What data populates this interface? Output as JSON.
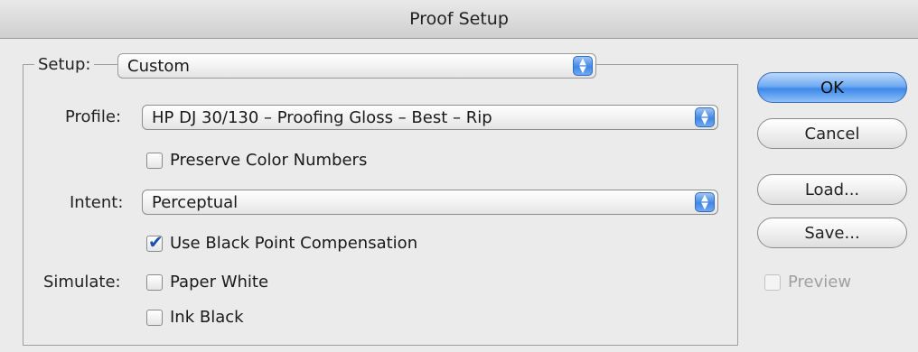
{
  "window": {
    "title": "Proof Setup"
  },
  "setup": {
    "label": "Setup:",
    "value": "Custom"
  },
  "profile": {
    "label": "Profile:",
    "value": "HP DJ 30/130 – Proofing Gloss – Best – Rip"
  },
  "preserve_color_numbers": {
    "label": "Preserve Color Numbers",
    "checked": false
  },
  "intent": {
    "label": "Intent:",
    "value": "Perceptual"
  },
  "black_point": {
    "label": "Use Black Point Compensation",
    "checked": true
  },
  "simulate": {
    "label": "Simulate:",
    "paper_white": {
      "label": "Paper White",
      "checked": false
    },
    "ink_black": {
      "label": "Ink Black",
      "checked": false
    }
  },
  "buttons": {
    "ok": "OK",
    "cancel": "Cancel",
    "load": "Load...",
    "save": "Save..."
  },
  "preview": {
    "label": "Preview",
    "checked": false,
    "enabled": false
  },
  "colors": {
    "accent": "#3d88ea"
  }
}
